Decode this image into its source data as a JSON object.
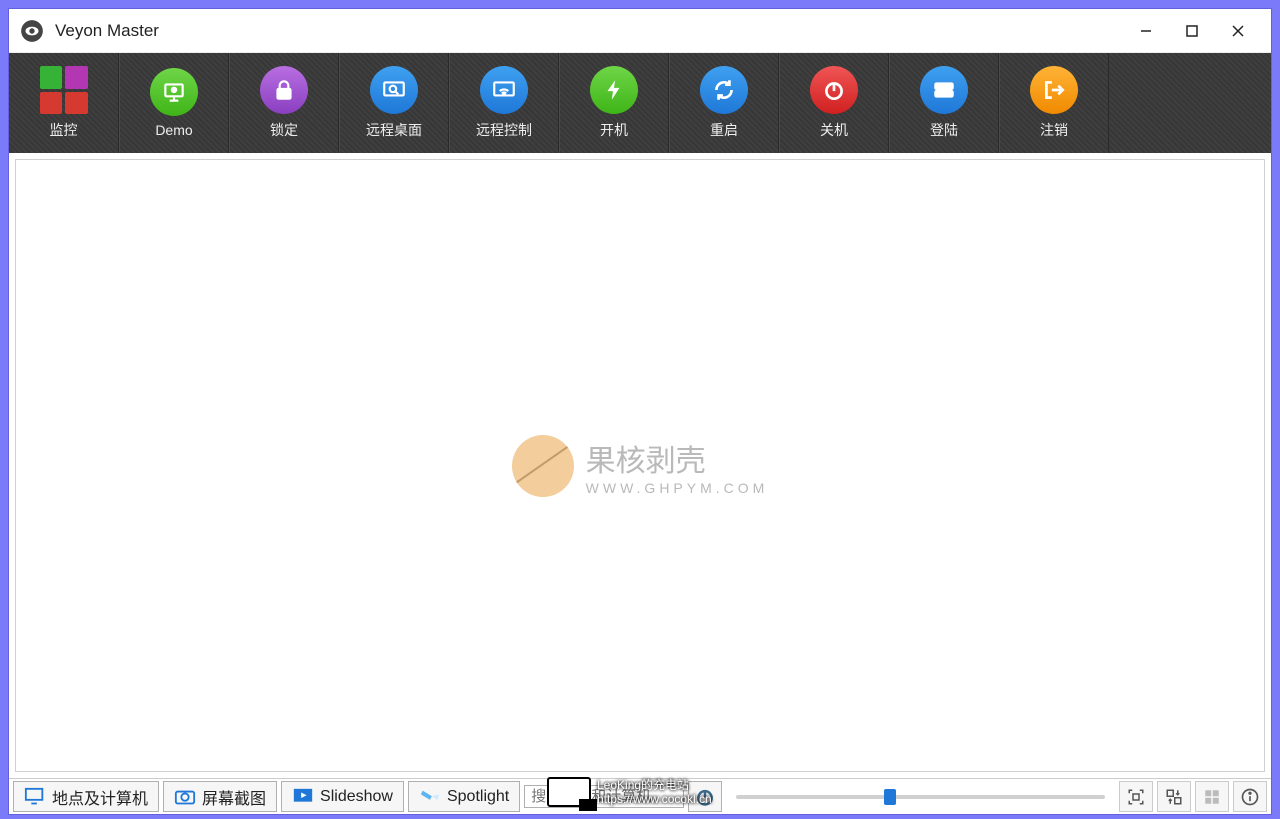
{
  "window": {
    "title": "Veyon Master"
  },
  "toolbar": [
    {
      "id": "monitor",
      "label": "监控",
      "icon": "monitor-grid",
      "color": ""
    },
    {
      "id": "demo",
      "label": "Demo",
      "icon": "presentation",
      "color": "green"
    },
    {
      "id": "lock",
      "label": "锁定",
      "icon": "lock",
      "color": "purple"
    },
    {
      "id": "remote-d",
      "label": "远程桌面",
      "icon": "magnify",
      "color": "blue"
    },
    {
      "id": "remote-c",
      "label": "远程控制",
      "icon": "wifi",
      "color": "blue"
    },
    {
      "id": "poweron",
      "label": "开机",
      "icon": "bolt",
      "color": "green"
    },
    {
      "id": "reboot",
      "label": "重启",
      "icon": "refresh",
      "color": "blue"
    },
    {
      "id": "shutdown",
      "label": "关机",
      "icon": "power",
      "color": "red"
    },
    {
      "id": "login",
      "label": "登陆",
      "icon": "server",
      "color": "blue"
    },
    {
      "id": "logout",
      "label": "注销",
      "icon": "exit",
      "color": "orange"
    }
  ],
  "watermark": {
    "line1": "果核剥壳",
    "line2": "WWW.GHPYM.COM"
  },
  "bottombar": {
    "tabs": [
      {
        "id": "locations",
        "label": "地点及计算机"
      },
      {
        "id": "screenshot",
        "label": "屏幕截图"
      },
      {
        "id": "slideshow",
        "label": "Slideshow"
      },
      {
        "id": "spotlight",
        "label": "Spotlight"
      }
    ],
    "search_placeholder": "搜索用户和计算机"
  },
  "overlay": {
    "line1": "LeoKing的充电站",
    "line2": "https://www.cocokl.cn"
  }
}
